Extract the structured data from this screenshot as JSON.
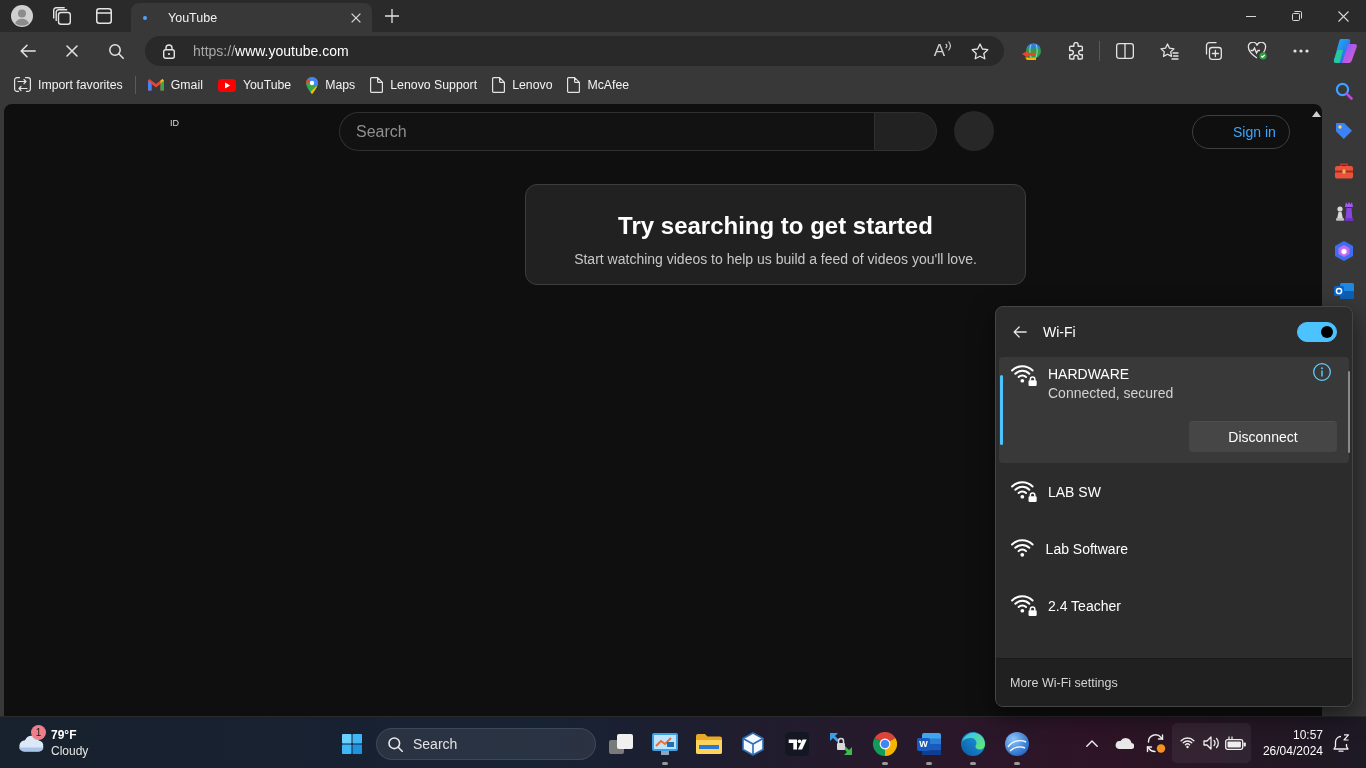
{
  "tab_strip": {
    "tabs": [
      {
        "title": "YouTube",
        "selected": true
      }
    ]
  },
  "toolbar": {
    "url_scheme": "https://",
    "url_host": "www.youtube.com",
    "read_aloud_glyph": "A"
  },
  "favorites_bar": {
    "items": [
      {
        "kind": "import",
        "label": "Import favorites"
      },
      {
        "kind": "gmail",
        "label": "Gmail"
      },
      {
        "kind": "youtube",
        "label": "YouTube"
      },
      {
        "kind": "maps",
        "label": "Maps"
      },
      {
        "kind": "page",
        "label": "Lenovo Support"
      },
      {
        "kind": "page",
        "label": "Lenovo"
      },
      {
        "kind": "page",
        "label": "McAfee"
      }
    ]
  },
  "page": {
    "corner_label": "ID",
    "search": {
      "placeholder": "Search"
    },
    "sign_in": "Sign in",
    "prompt": {
      "title": "Try searching to get started",
      "text": "Start watching videos to help us build a feed of videos you'll love."
    }
  },
  "wifi_panel": {
    "title": "Wi-Fi",
    "on": true,
    "networks": [
      {
        "name": "HARDWARE",
        "secured": true,
        "selected": true,
        "status": "Connected, secured",
        "action": "Disconnect"
      },
      {
        "name": "LAB SW",
        "secured": true,
        "selected": false
      },
      {
        "name": "Lab Software",
        "secured": false,
        "selected": false
      },
      {
        "name": "2.4 Teacher",
        "secured": true,
        "selected": false
      }
    ],
    "footer": "More Wi-Fi settings"
  },
  "taskbar": {
    "weather": {
      "badge": "1",
      "temperature": "79°F",
      "condition": "Cloudy"
    },
    "search": {
      "placeholder": "Search"
    },
    "apps": [
      {
        "kind": "task-view",
        "running": false
      },
      {
        "kind": "chart-window",
        "running": true
      },
      {
        "kind": "folder",
        "running": false
      },
      {
        "kind": "cube",
        "running": false
      },
      {
        "kind": "tile-logo",
        "running": false
      },
      {
        "kind": "lock-arrows",
        "running": false
      },
      {
        "kind": "chrome",
        "running": true
      },
      {
        "kind": "word",
        "running": true,
        "glyph": "W"
      },
      {
        "kind": "edge",
        "running": true
      },
      {
        "kind": "orb",
        "running": true
      }
    ],
    "clock": {
      "time": "10:57",
      "date": "26/04/2024"
    }
  }
}
